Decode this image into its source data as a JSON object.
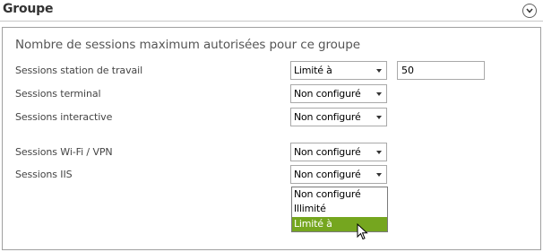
{
  "group": {
    "title": "Groupe",
    "toggle_icon": "chevron-down-circle-icon"
  },
  "section": {
    "title": "Nombre de sessions maximum autorisées pour ce groupe"
  },
  "rows": [
    {
      "label": "Sessions station de travail",
      "value": "Limité à",
      "limit": "50"
    },
    {
      "label": "Sessions terminal",
      "value": "Non configuré"
    },
    {
      "label": "Sessions interactive",
      "value": "Non configuré"
    },
    {
      "label": "Sessions Wi-Fi / VPN",
      "value": "Non configuré"
    },
    {
      "label": "Sessions IIS",
      "value": "Non configuré"
    }
  ],
  "dropdown": {
    "options": [
      "Non configuré",
      "Illimité",
      "Limité à"
    ],
    "highlighted": "Limité à",
    "highlight_color": "#75a61f"
  }
}
